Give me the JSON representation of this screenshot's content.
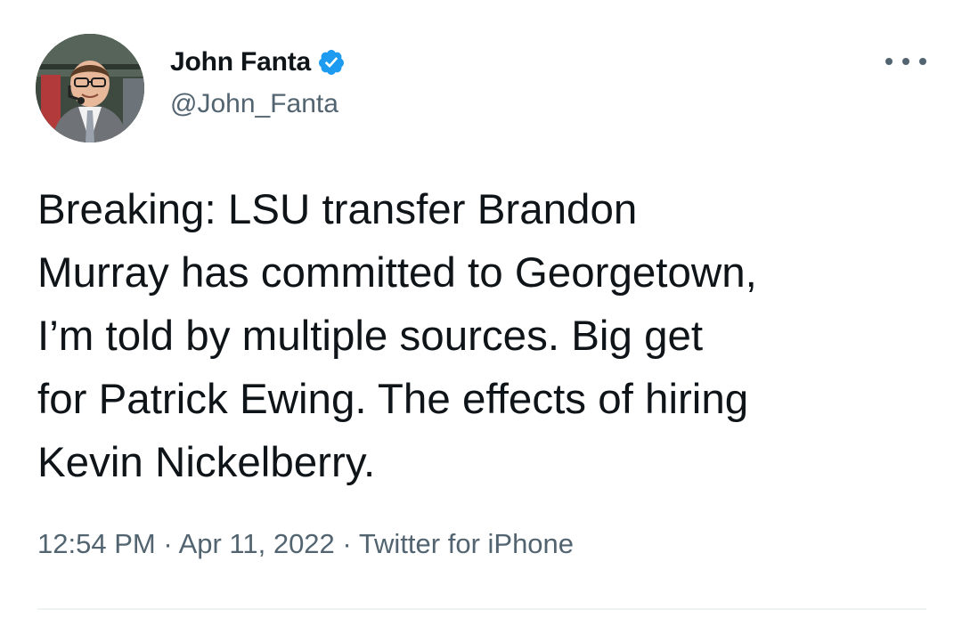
{
  "tweet": {
    "author": {
      "display_name": "John Fanta",
      "handle": "@John_Fanta",
      "verified": true,
      "avatar_icon": "profile-photo"
    },
    "text": "Breaking: LSU transfer Brandon\nMurray has committed to Georgetown,\nI’m told by multiple sources. Big get\nfor Patrick Ewing. The effects of hiring\nKevin Nickelberry.",
    "time": "12:54 PM",
    "separator": "·",
    "date": "Apr 11, 2022",
    "source": "Twitter for iPhone",
    "more_icon": "more-horizontal-icon"
  },
  "colors": {
    "text_primary": "#0f1419",
    "text_secondary": "#536471",
    "verified_blue": "#1d9bf0",
    "divider": "#eff3f4"
  }
}
